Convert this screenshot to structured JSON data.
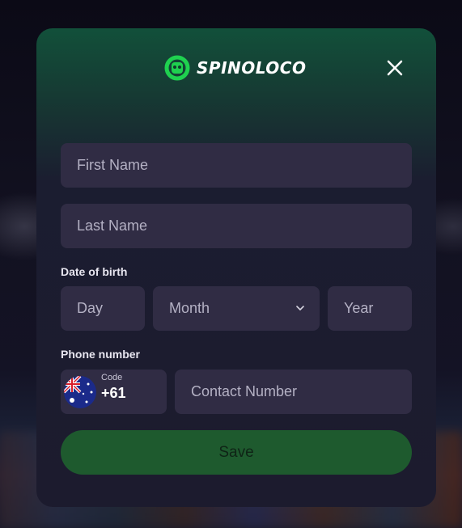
{
  "brand": {
    "name": "SPINOLOCO",
    "accent_color": "#1fd14f"
  },
  "form": {
    "first_name_placeholder": "First Name",
    "last_name_placeholder": "Last Name",
    "dob_label": "Date of birth",
    "day_placeholder": "Day",
    "month_placeholder": "Month",
    "year_placeholder": "Year",
    "phone_label": "Phone number",
    "code_label": "Code",
    "code_value": "+61",
    "contact_placeholder": "Contact Number",
    "save_label": "Save"
  },
  "icons": {
    "logo": "spinoloco-logo-icon",
    "close": "close-icon",
    "chevron": "chevron-down-icon",
    "flag": "australia-flag-icon"
  },
  "colors": {
    "field_bg": "#302c44",
    "save_bg": "#1e5a2e",
    "modal_top": "#12503a",
    "modal_bottom": "#1c1b2e"
  }
}
